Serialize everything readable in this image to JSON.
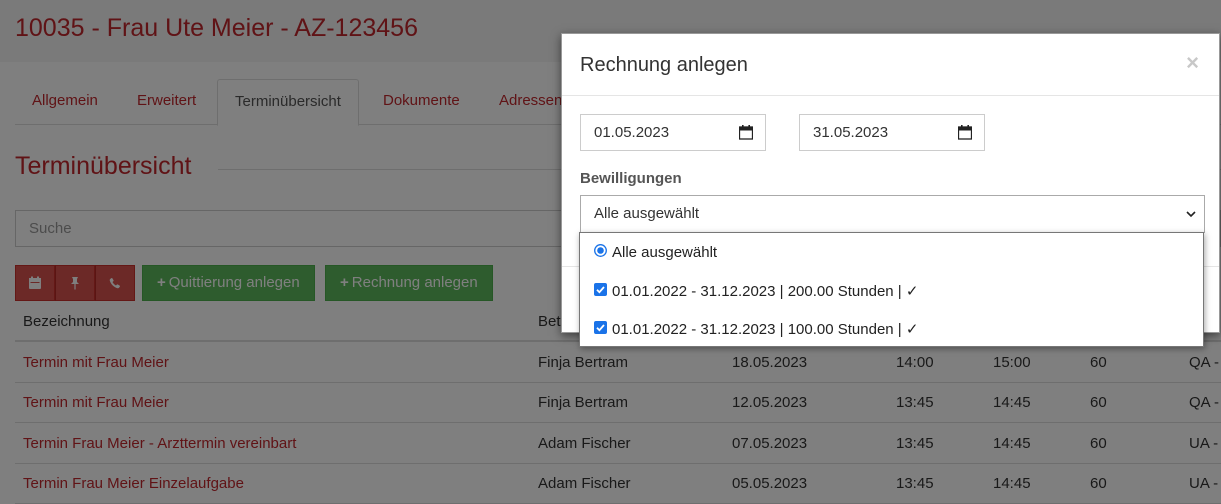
{
  "header": {
    "title": "10035 - Frau Ute Meier - AZ-123456"
  },
  "tabs": [
    {
      "label": "Allgemein"
    },
    {
      "label": "Erweitert"
    },
    {
      "label": "Terminübersicht"
    },
    {
      "label": "Dokumente"
    },
    {
      "label": "Adressen"
    }
  ],
  "section": {
    "title": "Terminübersicht"
  },
  "search": {
    "placeholder": "Suche"
  },
  "toolbar": {
    "calendar_icon": "calendar-icon",
    "pin_icon": "pin-icon",
    "phone_icon": "phone-icon",
    "quittierung_label": "Quittierung anlegen",
    "rechnung_label": "Rechnung anlegen"
  },
  "table": {
    "columns": [
      "Bezeichnung",
      "Bet"
    ],
    "rows": [
      {
        "name": "Termin mit Frau Meier",
        "person": "Finja Bertram",
        "date": "18.05.2023",
        "start": "14:00",
        "end": "15:00",
        "duration": "60",
        "code": "QA -"
      },
      {
        "name": "Termin mit Frau Meier",
        "person": "Finja Bertram",
        "date": "12.05.2023",
        "start": "13:45",
        "end": "14:45",
        "duration": "60",
        "code": "QA -"
      },
      {
        "name": "Termin Frau Meier - Arzttermin vereinbart",
        "person": "Adam Fischer",
        "date": "07.05.2023",
        "start": "13:45",
        "end": "14:45",
        "duration": "60",
        "code": "UA -"
      },
      {
        "name": "Termin Frau Meier Einzelaufgabe",
        "person": "Adam Fischer",
        "date": "05.05.2023",
        "start": "13:45",
        "end": "14:45",
        "duration": "60",
        "code": "UA -"
      }
    ]
  },
  "modal": {
    "title": "Rechnung anlegen",
    "close": "×",
    "date_from": "01.05.2023",
    "date_to": "31.05.2023",
    "label_bewilligungen": "Bewilligungen",
    "select_value": "Alle ausgewählt",
    "options": [
      {
        "label": "Alle ausgewählt",
        "type": "radio",
        "checked": true
      },
      {
        "label": "01.01.2022 - 31.12.2023 | 200.00 Stunden | ✓",
        "type": "checkbox",
        "checked": true
      },
      {
        "label": "01.01.2022 - 31.12.2023 | 100.00 Stunden | ✓",
        "type": "checkbox",
        "checked": true
      }
    ]
  },
  "colors": {
    "brand_red": "#c0272d",
    "button_red": "#d9534f",
    "button_green": "#5cb85c",
    "checkbox_blue": "#1a73e8"
  }
}
